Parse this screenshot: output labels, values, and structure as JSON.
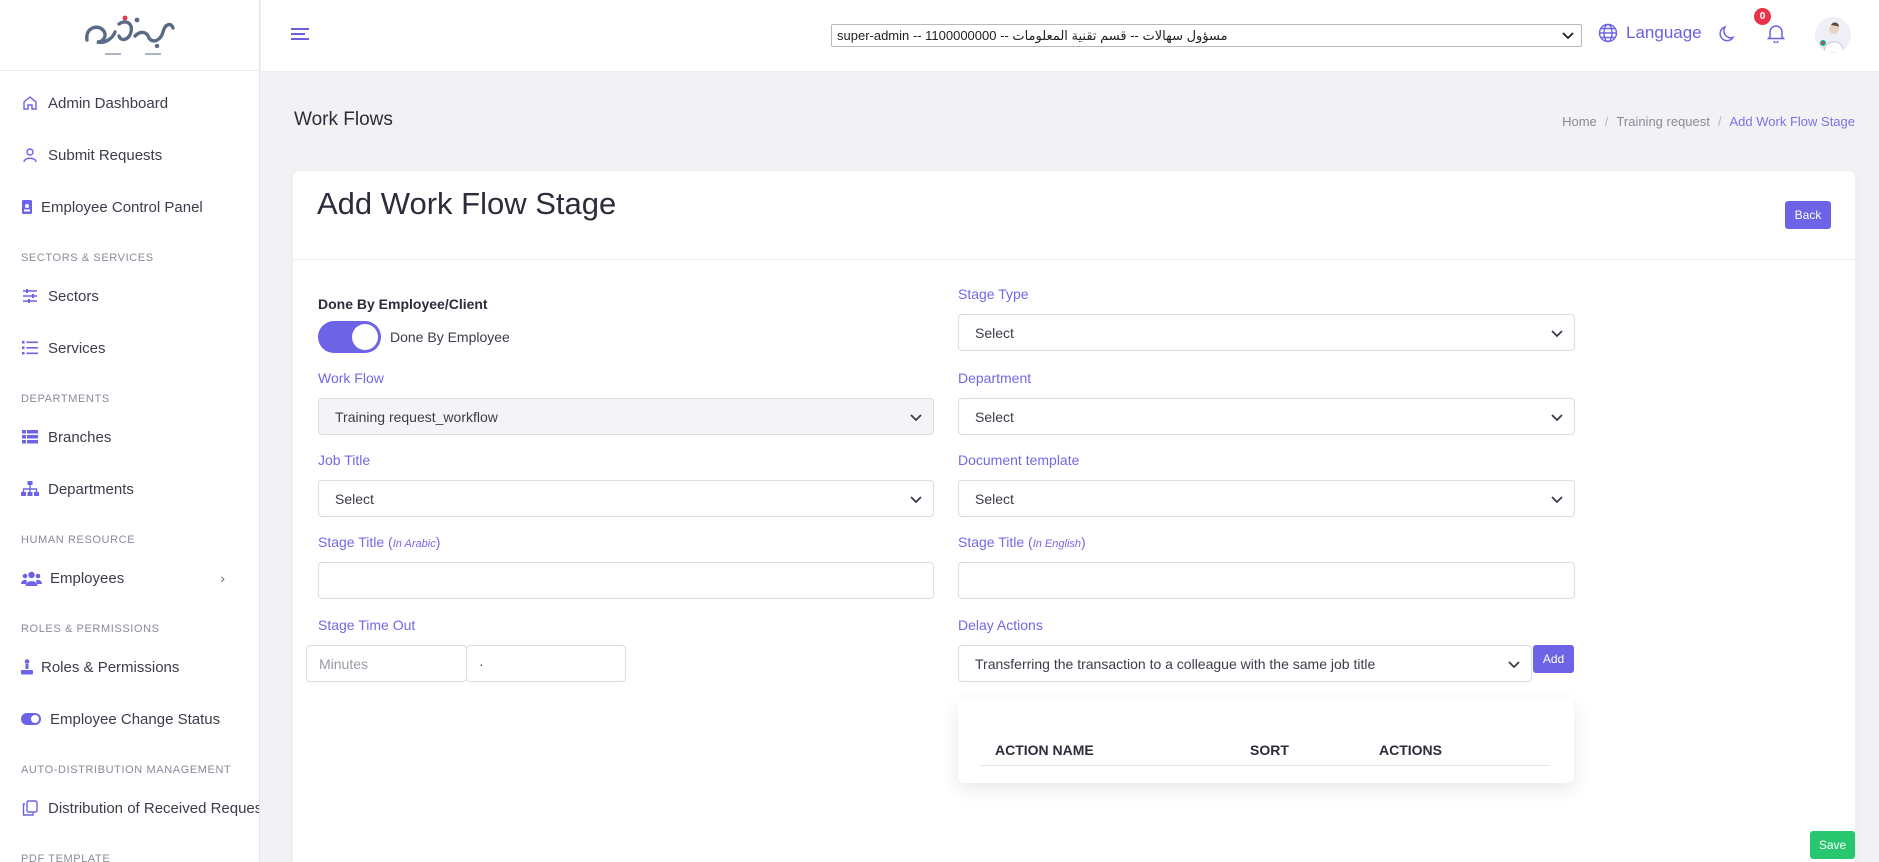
{
  "sidebar": {
    "logo_text": "MUAIN",
    "items": [
      {
        "label": "Admin Dashboard",
        "icon": "home-icon"
      },
      {
        "label": "Submit Requests",
        "icon": "user-icon"
      },
      {
        "label": "Employee Control Panel",
        "icon": "id-badge-icon"
      }
    ],
    "sections": [
      {
        "title": "SECTORS & SERVICES",
        "items": [
          {
            "label": "Sectors",
            "icon": "sliders-icon"
          },
          {
            "label": "Services",
            "icon": "list-icon"
          }
        ]
      },
      {
        "title": "DEPARTMENTS",
        "items": [
          {
            "label": "Branches",
            "icon": "table-list-icon"
          },
          {
            "label": "Departments",
            "icon": "sitemap-icon"
          }
        ]
      },
      {
        "title": "HUMAN RESOURCE",
        "items": [
          {
            "label": "Employees",
            "icon": "users-icon"
          }
        ]
      },
      {
        "title": "ROLES & PERMISSIONS",
        "items": [
          {
            "label": "Roles & Permissions",
            "icon": "person-podium-icon"
          },
          {
            "label": "Employee Change Status",
            "icon": "toggle-icon"
          }
        ]
      },
      {
        "title": "AUTO-DISTRIBUTION MANAGEMENT",
        "items": [
          {
            "label": "Distribution of Received Reques",
            "icon": "copy-icon"
          }
        ]
      },
      {
        "title": "PDF TEMPLATE",
        "items": []
      }
    ]
  },
  "topbar": {
    "account_select": "super-admin -- 1100000000 -- مسؤول سهالات -- قسم تقنية المعلومات",
    "language": "Language",
    "notifications_count": "0"
  },
  "page": {
    "title": "Work Flows",
    "breadcrumb": [
      "Home",
      "Training request",
      "Add Work Flow Stage"
    ]
  },
  "form": {
    "title": "Add Work Flow Stage",
    "back": "Back",
    "done_by_label": "Done By Employee/Client",
    "done_by_value": "Done By Employee",
    "work_flow_label": "Work Flow",
    "work_flow_value": "Training request_workflow",
    "job_title_label": "Job Title",
    "job_title_value": "Select",
    "stage_title_ar_label": "Stage Title (",
    "stage_title_ar_hint": "In Arabic",
    "stage_title_en_label": "Stage Title (",
    "stage_title_en_hint": "In English",
    "close_paren": ")",
    "timeout_label": "Stage Time Out",
    "timeout_unit_placeholder": "Minutes",
    "timeout_value": "·",
    "stage_type_label": "Stage Type",
    "stage_type_value": "Select",
    "department_label": "Department",
    "department_value": "Select",
    "doc_template_label": "Document template",
    "doc_template_value": "Select",
    "delay_actions_label": "Delay Actions",
    "delay_actions_value": "Transferring the transaction to a colleague with the same job title",
    "add": "Add",
    "table_headers": [
      "ACTION NAME",
      "SORT",
      "ACTIONS"
    ],
    "save": "Save"
  },
  "colors": {
    "accent": "#6c63e6",
    "save": "#28c76f",
    "badge": "#e8344a"
  }
}
